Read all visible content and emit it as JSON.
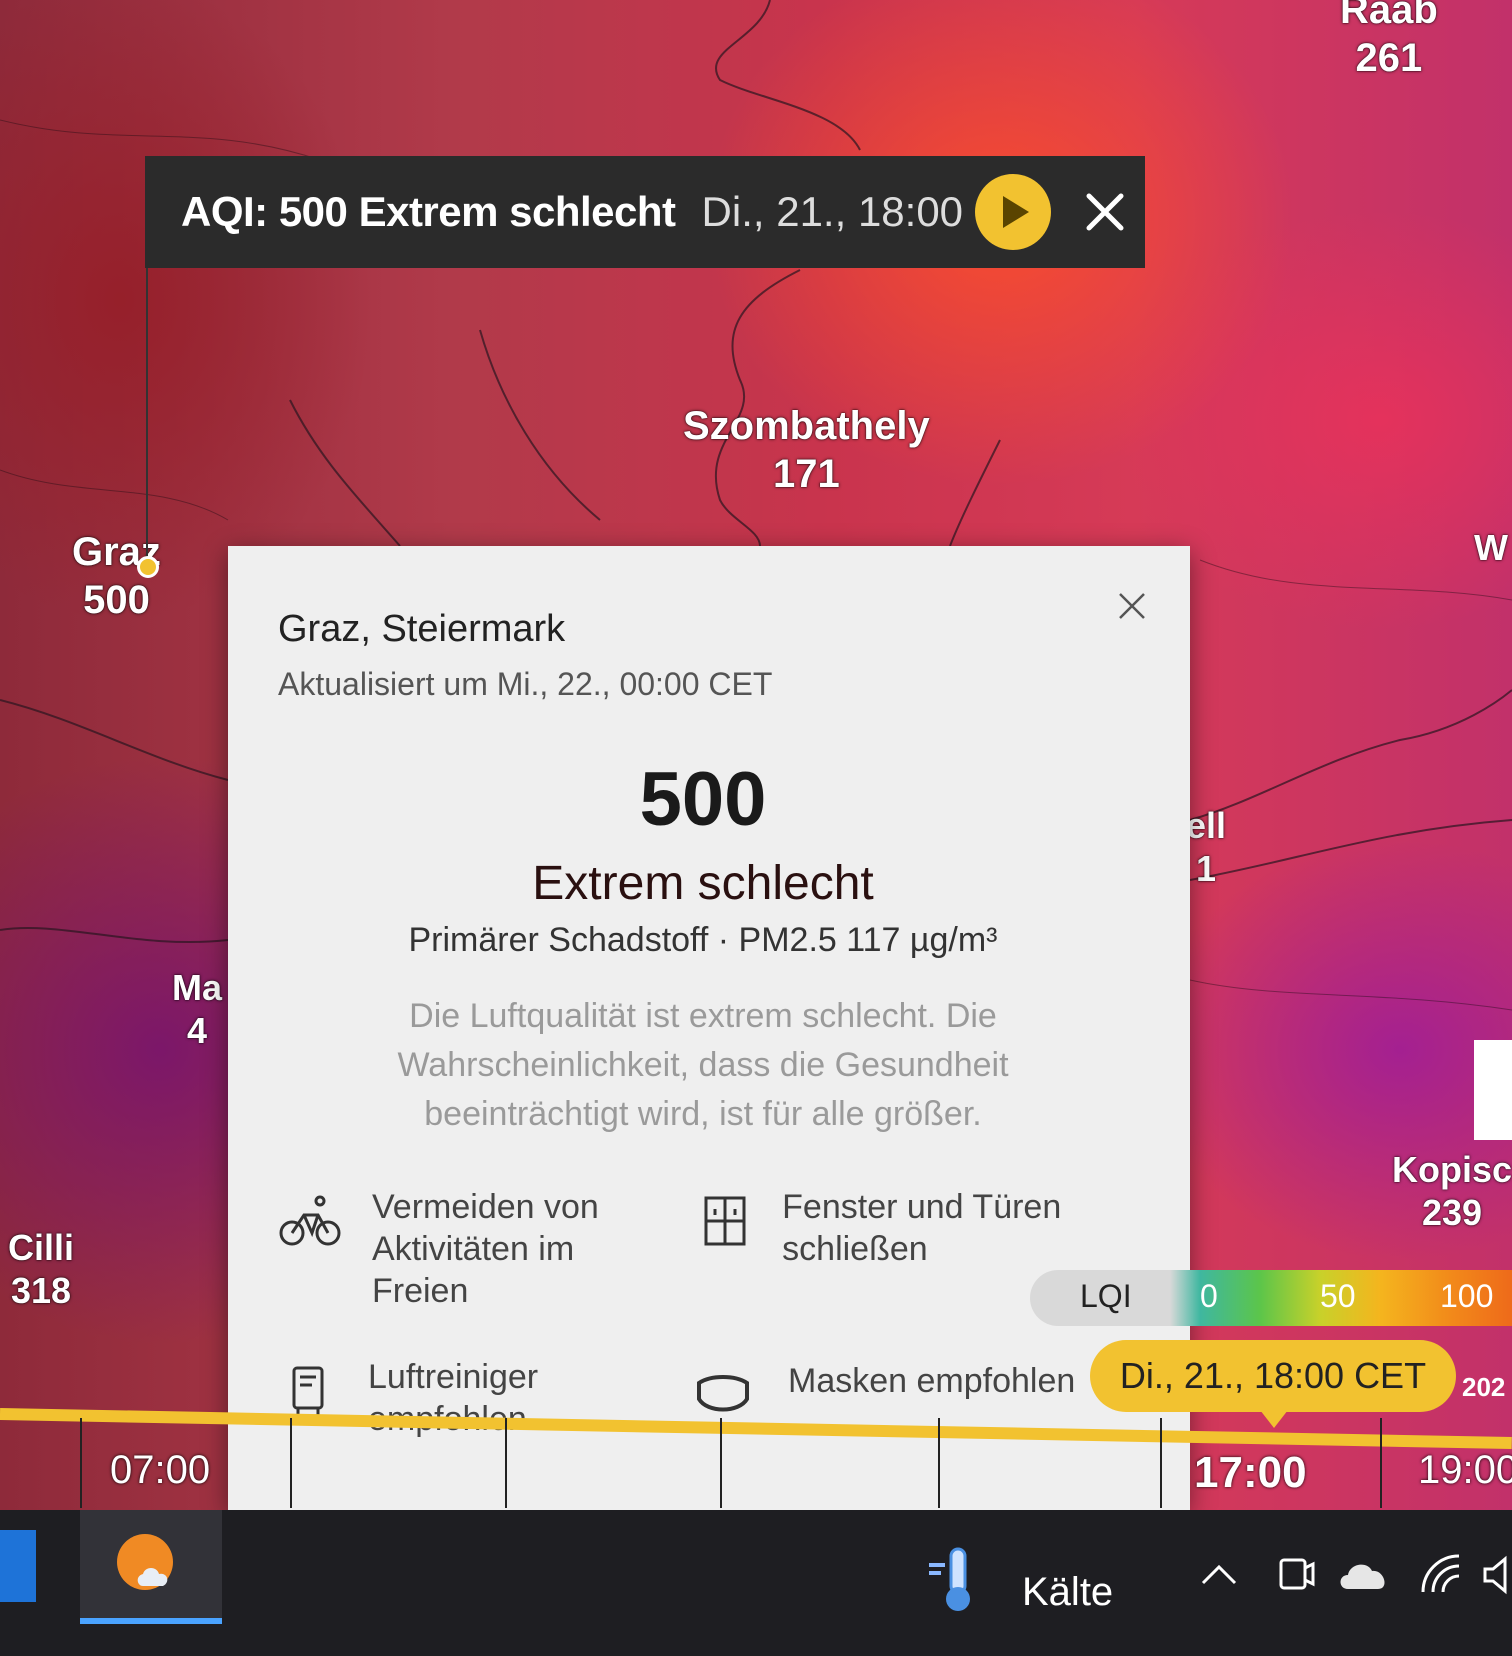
{
  "aqi_bar": {
    "title": "AQI: 500 Extrem schlecht",
    "datetime": "Di., 21., 18:00"
  },
  "cities": [
    {
      "name": "Raab",
      "value": "261"
    },
    {
      "name": "Szombathely",
      "value": "171"
    },
    {
      "name": "Graz",
      "value": "500"
    },
    {
      "name": "Cilli",
      "value": "318"
    },
    {
      "name": "Kopisc",
      "value": "239"
    },
    {
      "name": "Ma",
      "value": "4"
    },
    {
      "name": "ell",
      "value": "1"
    },
    {
      "name": "W",
      "value": ""
    }
  ],
  "card": {
    "location": "Graz, Steiermark",
    "updated": "Aktualisiert um Mi., 22., 00:00 CET",
    "aqi_value": "500",
    "category": "Extrem schlecht",
    "pollutant": "Primärer Schadstoff · PM2.5 117 µg/m³",
    "description": "Die Luftqualität ist extrem schlecht. Die Wahrscheinlichkeit, dass die Gesundheit beeinträchtigt wird, ist für alle größer.",
    "tips": [
      {
        "icon": "bicycle-icon",
        "label": "Vermeiden von Aktivitäten im Freien"
      },
      {
        "icon": "window-icon",
        "label": "Fenster und Türen schließen"
      },
      {
        "icon": "air-purifier-icon",
        "label": "Luftreiniger empfohlen"
      },
      {
        "icon": "mask-icon",
        "label": "Masken empfohlen"
      }
    ]
  },
  "legend": {
    "label": "LQI",
    "stops": [
      "0",
      "50",
      "100"
    ]
  },
  "timeline": {
    "selected": "Di., 21., 18:00 CET",
    "times": [
      "07:00",
      "17:00",
      "19:00"
    ],
    "partial_label": "202"
  },
  "taskbar": {
    "weather_label": "Kälte"
  },
  "colors": {
    "accent_yellow": "#f2c230",
    "bar_dark": "#2b2b2b",
    "card_bg": "#efefef"
  }
}
